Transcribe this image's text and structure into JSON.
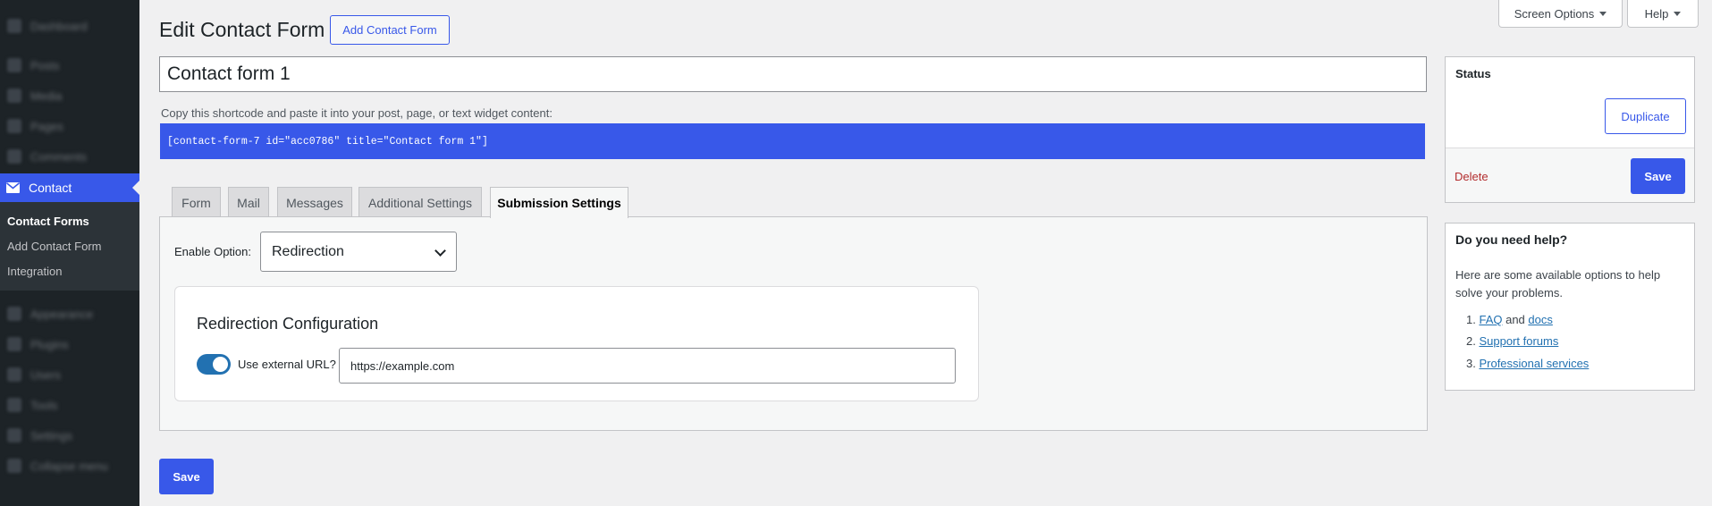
{
  "sidebar": {
    "items": [
      {
        "label": "Dashboard",
        "icon": "dashboard-icon"
      },
      {
        "label": "Posts",
        "icon": "pin-icon"
      },
      {
        "label": "Media",
        "icon": "media-icon"
      },
      {
        "label": "Pages",
        "icon": "page-icon"
      },
      {
        "label": "Comments",
        "icon": "comment-icon"
      }
    ],
    "current": {
      "label": "Contact",
      "icon": "envelope-icon"
    },
    "submenu": [
      "Contact Forms",
      "Add Contact Form",
      "Integration"
    ],
    "items_after": [
      {
        "label": "Appearance",
        "icon": "brush-icon"
      },
      {
        "label": "Plugins",
        "icon": "plugin-icon"
      },
      {
        "label": "Users",
        "icon": "users-icon"
      },
      {
        "label": "Tools",
        "icon": "wrench-icon"
      },
      {
        "label": "Settings",
        "icon": "settings-icon"
      },
      {
        "label": "Collapse menu",
        "icon": "collapse-icon"
      }
    ]
  },
  "top": {
    "screen_options": "Screen Options",
    "help": "Help"
  },
  "header": {
    "title": "Edit Contact Form",
    "add_new": "Add Contact Form"
  },
  "form": {
    "title_value": "Contact form 1",
    "shortcode_hint": "Copy this shortcode and paste it into your post, page, or text widget content:",
    "shortcode": "[contact-form-7 id=\"acc0786\" title=\"Contact form 1\"]"
  },
  "tabs": [
    "Form",
    "Mail",
    "Messages",
    "Additional Settings",
    "Submission Settings"
  ],
  "submission": {
    "enable_label": "Enable Option:",
    "enable_value": "Redirection",
    "config_title": "Redirection Configuration",
    "toggle_label": "Use external URL?",
    "toggle_on": true,
    "url_value": "https://example.com"
  },
  "bottom_save": "Save",
  "status_box": {
    "title": "Status",
    "duplicate": "Duplicate",
    "delete": "Delete",
    "save": "Save"
  },
  "help_box": {
    "title": "Do you need help?",
    "text": "Here are some available options to help solve your problems.",
    "items": [
      {
        "num": "1.",
        "link": "FAQ",
        "mid": " and ",
        "link2": "docs"
      },
      {
        "num": "2.",
        "link": "Support forums"
      },
      {
        "num": "3.",
        "link": "Professional services"
      }
    ]
  },
  "colors": {
    "accent": "#3858e9",
    "sidebar_bg": "#1d2327",
    "delete": "#b32d2e",
    "link": "#2271b1"
  }
}
